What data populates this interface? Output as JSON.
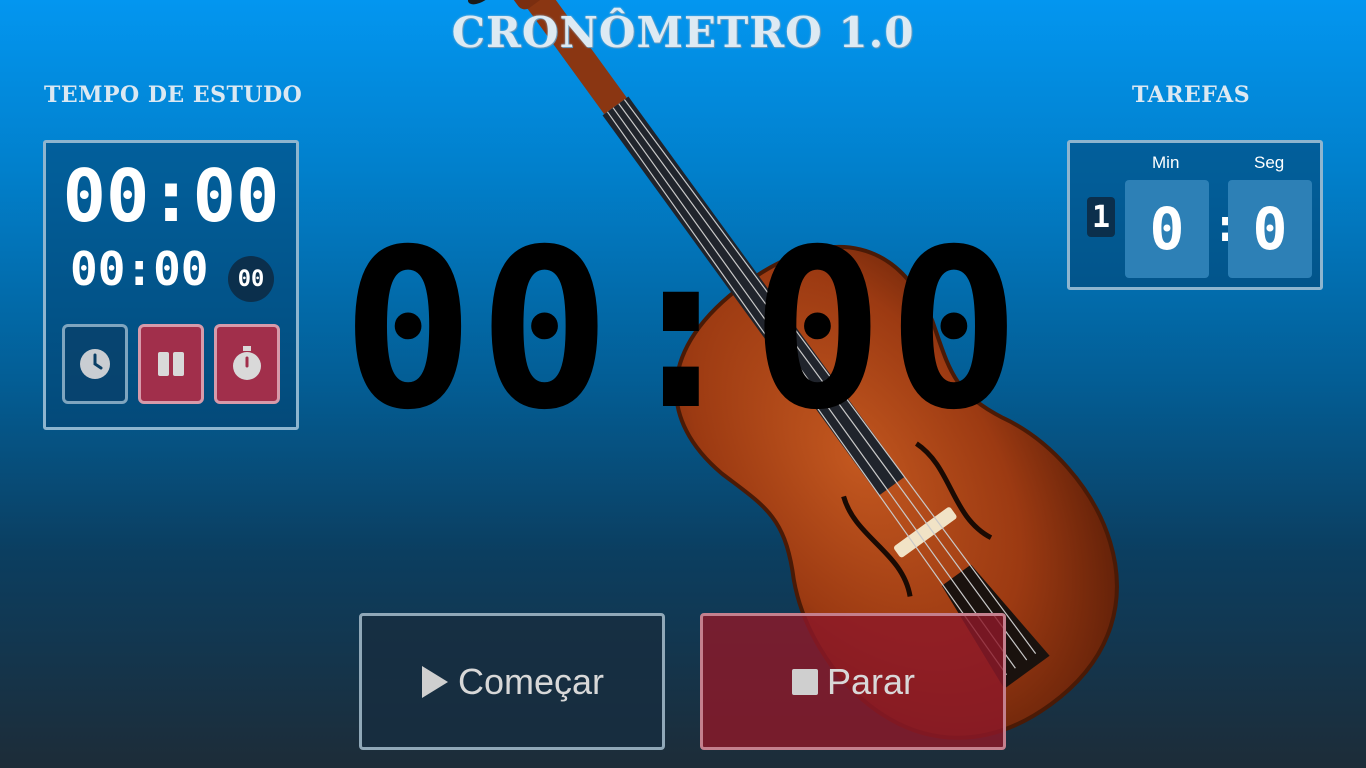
{
  "title": "CRONÔMETRO 1.0",
  "study": {
    "title": "TEMPO DE ESTUDO",
    "main_time": "00:00",
    "sub_time": "00:00",
    "sub_badge": "00",
    "buttons": {
      "clock_icon": "clock-icon",
      "pause_icon": "pause-icon",
      "stopwatch_icon": "stopwatch-icon"
    }
  },
  "tasks": {
    "title": "TAREFAS",
    "min_label": "Min",
    "seg_label": "Seg",
    "index": "1",
    "minutes": "0",
    "separator": ":",
    "seconds": "0"
  },
  "main_timer": "00:00",
  "controls": {
    "start_label": "Começar",
    "stop_label": "Parar"
  },
  "colors": {
    "accent_red": "#a12f4b",
    "bg_top": "#0396f0",
    "bg_bottom": "#1d2c38"
  }
}
